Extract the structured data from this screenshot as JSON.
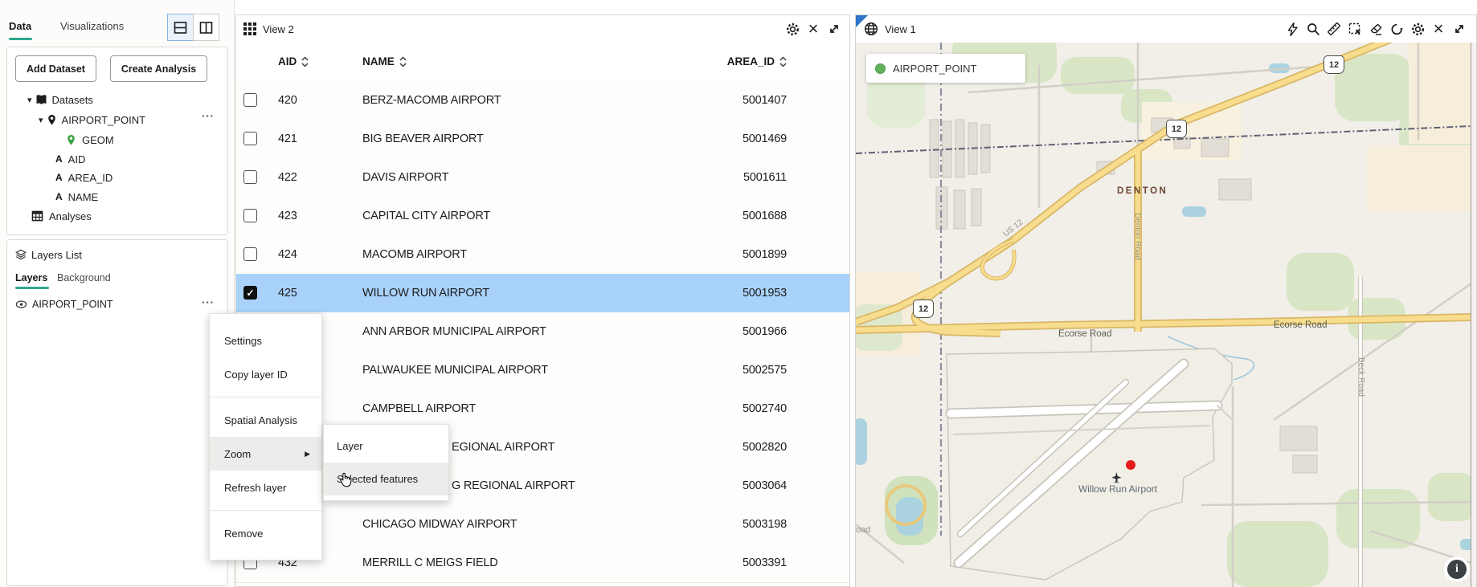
{
  "sidebar": {
    "tabs": {
      "data": "Data",
      "visualizations": "Visualizations"
    },
    "dataset_panel": {
      "add_dataset": "Add Dataset",
      "create_analysis": "Create Analysis",
      "datasets_root": "Datasets",
      "dataset_name": "AIRPORT_POINT",
      "fields": {
        "geom": "GEOM",
        "aid": "AID",
        "area_id": "AREA_ID",
        "name": "NAME"
      },
      "analyses": "Analyses"
    },
    "layers_panel": {
      "title": "Layers List",
      "tabs": {
        "layers": "Layers",
        "background": "Background"
      },
      "layer_name": "AIRPORT_POINT"
    }
  },
  "table_panel": {
    "title": "View 2",
    "columns": {
      "aid": "AID",
      "name": "NAME",
      "area_id": "AREA_ID"
    },
    "rows": [
      {
        "aid": "420",
        "name": "BERZ-MACOMB AIRPORT",
        "area_id": "5001407"
      },
      {
        "aid": "421",
        "name": "BIG BEAVER AIRPORT",
        "area_id": "5001469"
      },
      {
        "aid": "422",
        "name": "DAVIS AIRPORT",
        "area_id": "5001611"
      },
      {
        "aid": "423",
        "name": "CAPITAL CITY AIRPORT",
        "area_id": "5001688"
      },
      {
        "aid": "424",
        "name": "MACOMB AIRPORT",
        "area_id": "5001899"
      },
      {
        "aid": "425",
        "name": "WILLOW RUN AIRPORT",
        "area_id": "5001953"
      },
      {
        "aid": "",
        "name": "ANN ARBOR MUNICIPAL AIRPORT",
        "area_id": "5001966"
      },
      {
        "aid": "",
        "name": "PALWAUKEE MUNICIPAL AIRPORT",
        "area_id": "5002575"
      },
      {
        "aid": "",
        "name": "CAMPBELL AIRPORT",
        "area_id": "5002740"
      },
      {
        "aid": "",
        "name": "EGIONAL AIRPORT",
        "area_id": "5002820"
      },
      {
        "aid": "",
        "name": "G REGIONAL AIRPORT",
        "area_id": "5003064"
      },
      {
        "aid": "",
        "name": "CHICAGO MIDWAY AIRPORT",
        "area_id": "5003198"
      },
      {
        "aid": "432",
        "name": "MERRILL C MEIGS FIELD",
        "area_id": "5003391"
      }
    ]
  },
  "context_menu": {
    "settings": "Settings",
    "copy_layer_id": "Copy layer ID",
    "spatial_analysis": "Spatial Analysis",
    "zoom": "Zoom",
    "refresh_layer": "Refresh layer",
    "remove": "Remove",
    "submenu": {
      "layer": "Layer",
      "selected_features": "Selected features"
    }
  },
  "map_panel": {
    "title": "View 1",
    "legend": {
      "label": "AIRPORT_POINT",
      "color": "#63b05f"
    },
    "shield": "12",
    "labels": {
      "town": "DENTON",
      "us12": "US 12",
      "ecorse_road": "Ecorse Road",
      "denton_road": "Denton Road",
      "beck_road": "Beck Road",
      "airport": "Willow Run Airport",
      "partial_road": "oad"
    },
    "info": "i"
  },
  "icons": {
    "caret_down": "▾",
    "overflow": "···",
    "submenu_arrow": "▶",
    "close": "×",
    "check": "✓"
  },
  "colors": {
    "accent": "#2ea78d",
    "row_selected": "#a9d2fb",
    "point_red": "#e41c1c",
    "legend_green": "#63b05f"
  }
}
